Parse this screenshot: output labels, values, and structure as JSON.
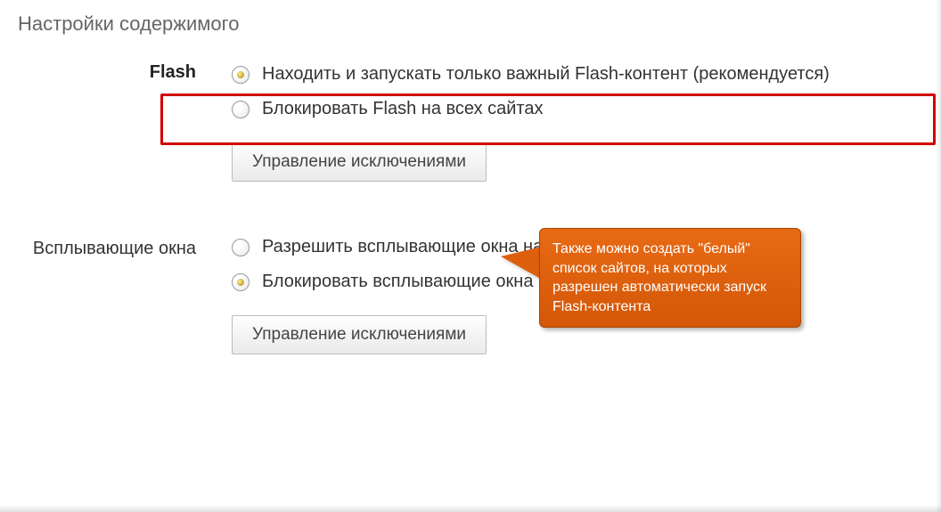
{
  "page_title": "Настройки содержимого",
  "flash": {
    "label": "Flash",
    "option_run": "Находить и запускать только важный Flash-контент (рекомендуется)",
    "option_block": "Блокировать Flash на всех сайтах",
    "selected": "run",
    "manage_button": "Управление исключениями"
  },
  "popups": {
    "label": "Всплывающие окна",
    "option_allow": "Разрешить всплывающие окна на всех сайтах",
    "option_block": "Блокировать всплывающие окна на всех сайтах (рекомендуется)",
    "selected": "block",
    "manage_button": "Управление исключениями"
  },
  "callout": {
    "text": "Также можно создать \"белый\" список сайтов, на которых разрешен автоматически запуск Flash-контента"
  },
  "colors": {
    "highlight": "#d10000",
    "callout_bg": "#e1610e"
  }
}
